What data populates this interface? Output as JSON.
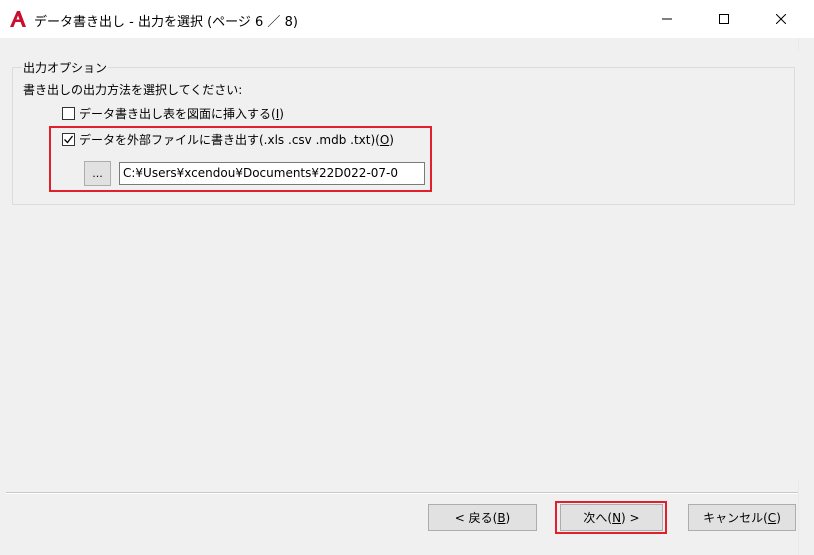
{
  "window": {
    "title": "データ書き出し - 出力を選択 (ページ 6 ／ 8)",
    "app_icon": "autocad-icon",
    "controls": [
      "minimize-icon",
      "maximize-icon",
      "close-icon"
    ]
  },
  "output_options": {
    "group_label": "出力オプション",
    "instruction": "書き出しの出力方法を選択してください:",
    "insert_table": {
      "label": "データ書き出し表を図面に挿入する(",
      "mnemonic": "I",
      "suffix": ")",
      "checked": false
    },
    "export_file": {
      "label": "データを外部ファイルに書き出す(.xls .csv .mdb .txt)(",
      "mnemonic": "O",
      "suffix": ")",
      "checked": true
    },
    "browse_label": "...",
    "file_path": "C:¥Users¥xcendou¥Documents¥22D022-07-0"
  },
  "buttons": {
    "back": {
      "label": "< 戻る(",
      "mnemonic": "B",
      "suffix": ")"
    },
    "next": {
      "label": "次へ(",
      "mnemonic": "N",
      "suffix": ") >"
    },
    "cancel": {
      "label": "キャンセル(",
      "mnemonic": "C",
      "suffix": ")"
    }
  },
  "colors": {
    "highlight": "#e0202a",
    "app_icon": "#c8102e"
  }
}
